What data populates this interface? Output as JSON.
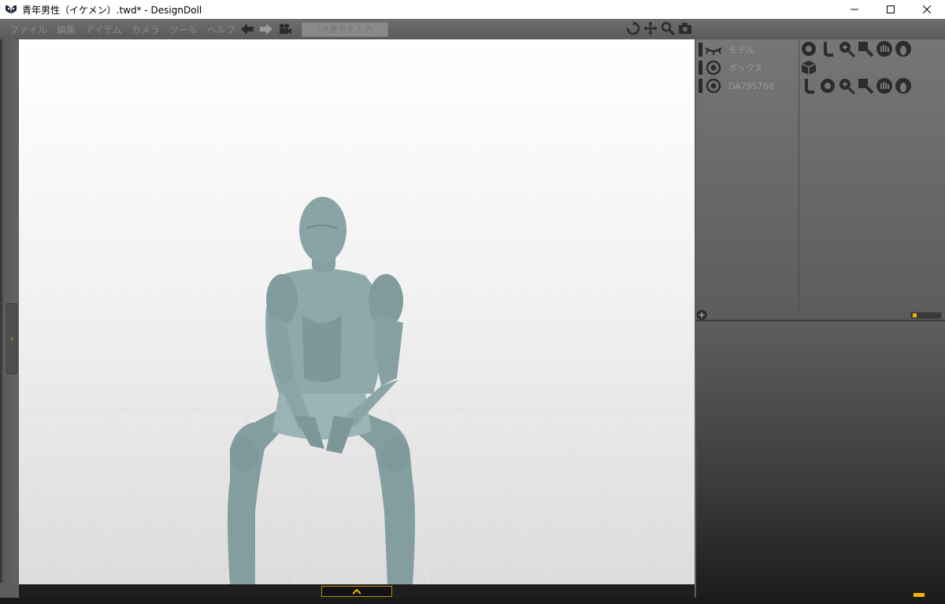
{
  "window": {
    "title": "青年男性（イケメン）.twd* - DesignDoll",
    "controls": [
      "minimize-icon",
      "maximize-icon",
      "close-icon"
    ]
  },
  "menu": {
    "items": [
      "ファイル",
      "編集",
      "アイテム",
      "カメラ",
      "ツール",
      "ヘルプ"
    ],
    "da_placeholder": "DA番号を入力",
    "nav_icons": [
      "back-arrow-icon",
      "forward-arrow-icon",
      "video-camera-icon"
    ]
  },
  "camera_tools": [
    "rotate-icon",
    "move-icon",
    "zoom-icon",
    "camera-icon"
  ],
  "outline": {
    "items": [
      {
        "label": "モデル",
        "icon": "eye-closed-icon"
      },
      {
        "label": "ボックス",
        "icon": "eye-open-icon"
      },
      {
        "label": "DA795768",
        "icon": "eye-open-icon"
      }
    ]
  },
  "colors": {
    "accent": "#f2b600",
    "panel_bg": "#5e5e5e",
    "figure": "#8aa4a6",
    "viewport_top": "#ffffff",
    "viewport_bottom": "#dcdcdc"
  }
}
